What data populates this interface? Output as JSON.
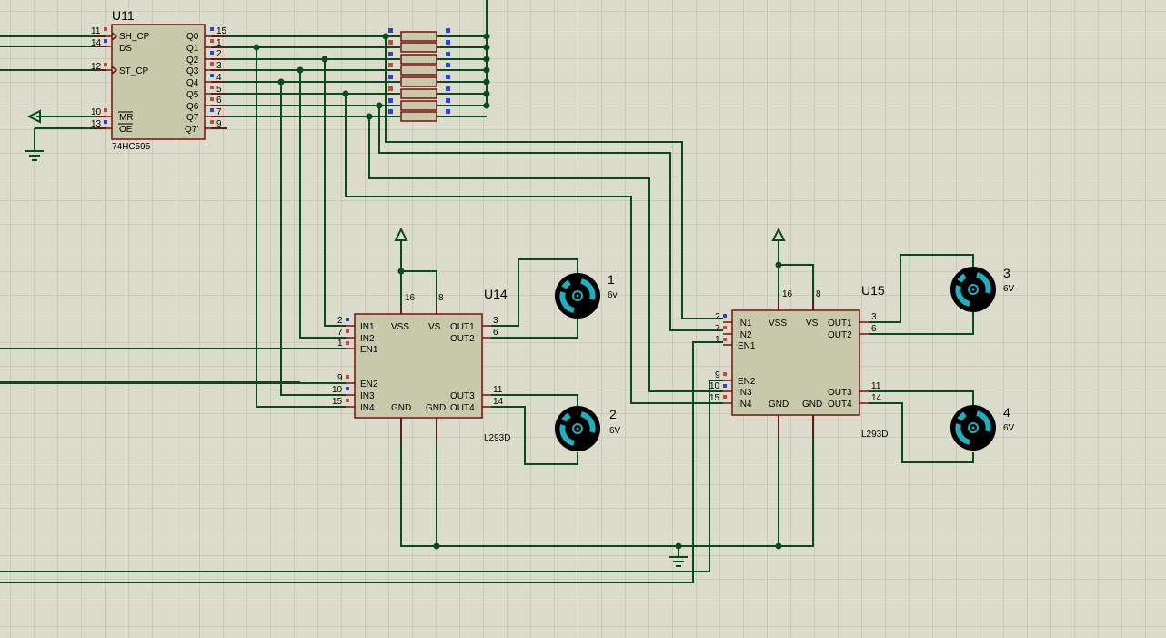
{
  "colors": {
    "wire": "#0b4a1a",
    "body": "#c8c8aa",
    "outline": "#7a0f0f",
    "pin_red": "#d84040",
    "pin_blue": "#3040e0",
    "motor_ring": "#1fb0c0"
  },
  "u11": {
    "ref": "U11",
    "part": "74HC595",
    "left_pins": [
      {
        "num": "11",
        "name": "SH_CP"
      },
      {
        "num": "14",
        "name": "DS"
      },
      {
        "num": "12",
        "name": "ST_CP"
      },
      {
        "num": "10",
        "name": "MR"
      },
      {
        "num": "13",
        "name": "OE"
      }
    ],
    "right_pins": [
      {
        "num": "15",
        "name": "Q0"
      },
      {
        "num": "1",
        "name": "Q1"
      },
      {
        "num": "2",
        "name": "Q2"
      },
      {
        "num": "3",
        "name": "Q3"
      },
      {
        "num": "4",
        "name": "Q4"
      },
      {
        "num": "5",
        "name": "Q5"
      },
      {
        "num": "6",
        "name": "Q6"
      },
      {
        "num": "7",
        "name": "Q7"
      },
      {
        "num": "9",
        "name": "Q7'"
      }
    ]
  },
  "u14": {
    "ref": "U14",
    "part": "L293D",
    "pin_vss": "16",
    "pin_vs": "8",
    "lbl_vss": "VSS",
    "lbl_vs": "VS",
    "lbl_gnd1": "GND",
    "lbl_gnd2": "GND",
    "left_pins": [
      {
        "num": "2",
        "name": "IN1"
      },
      {
        "num": "7",
        "name": "IN2"
      },
      {
        "num": "1",
        "name": "EN1"
      },
      {
        "num": "9",
        "name": "EN2"
      },
      {
        "num": "10",
        "name": "IN3"
      },
      {
        "num": "15",
        "name": "IN4"
      }
    ],
    "right_pins": [
      {
        "num": "3",
        "name": "OUT1"
      },
      {
        "num": "6",
        "name": "OUT2"
      },
      {
        "num": "11",
        "name": "OUT3"
      },
      {
        "num": "14",
        "name": "OUT4"
      }
    ]
  },
  "u15": {
    "ref": "U15",
    "part": "L293D",
    "pin_vss": "16",
    "pin_vs": "8",
    "lbl_vss": "VSS",
    "lbl_vs": "VS",
    "lbl_gnd1": "GND",
    "lbl_gnd2": "GND",
    "left_pins": [
      {
        "num": "2",
        "name": "IN1"
      },
      {
        "num": "7",
        "name": "IN2"
      },
      {
        "num": "1",
        "name": "EN1"
      },
      {
        "num": "9",
        "name": "EN2"
      },
      {
        "num": "10",
        "name": "IN3"
      },
      {
        "num": "15",
        "name": "IN4"
      }
    ],
    "right_pins": [
      {
        "num": "3",
        "name": "OUT1"
      },
      {
        "num": "6",
        "name": "OUT2"
      },
      {
        "num": "11",
        "name": "OUT3"
      },
      {
        "num": "14",
        "name": "OUT4"
      }
    ]
  },
  "motors": [
    {
      "ref": "1",
      "voltage": "6v"
    },
    {
      "ref": "2",
      "voltage": "6V"
    },
    {
      "ref": "3",
      "voltage": "6V"
    },
    {
      "ref": "4",
      "voltage": "6V"
    }
  ]
}
